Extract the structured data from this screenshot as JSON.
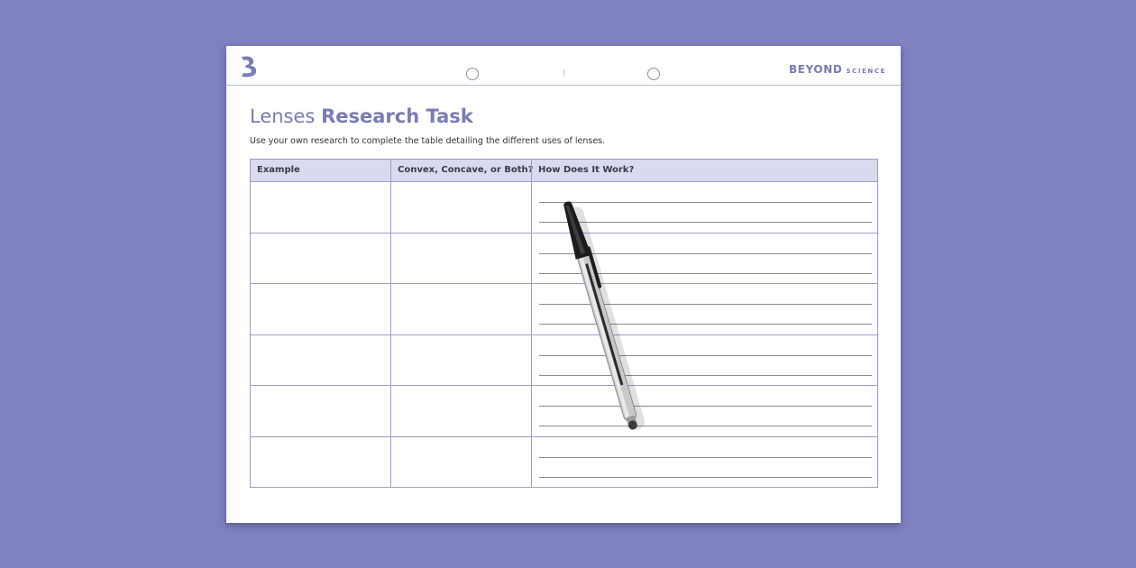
{
  "header": {
    "brand_primary": "BEYOND",
    "brand_secondary": "SCIENCE"
  },
  "worksheet": {
    "title_light": "Lenses",
    "title_bold": "Research Task",
    "instructions": "Use your own research to complete the table detailing the different uses of lenses."
  },
  "table": {
    "columns": [
      "Example",
      "Convex, Concave, or Both?",
      "How Does It Work?"
    ],
    "row_count": 6,
    "writing_lines_per_row": 2
  },
  "colors": {
    "background": "#7f82bf",
    "accent": "#7a7cb3",
    "header_fill": "#d9daf0",
    "border": "#9c9ec9"
  },
  "icons": {
    "logo": "beyond-b-logo-icon",
    "pen": "ballpoint-pen-icon"
  }
}
